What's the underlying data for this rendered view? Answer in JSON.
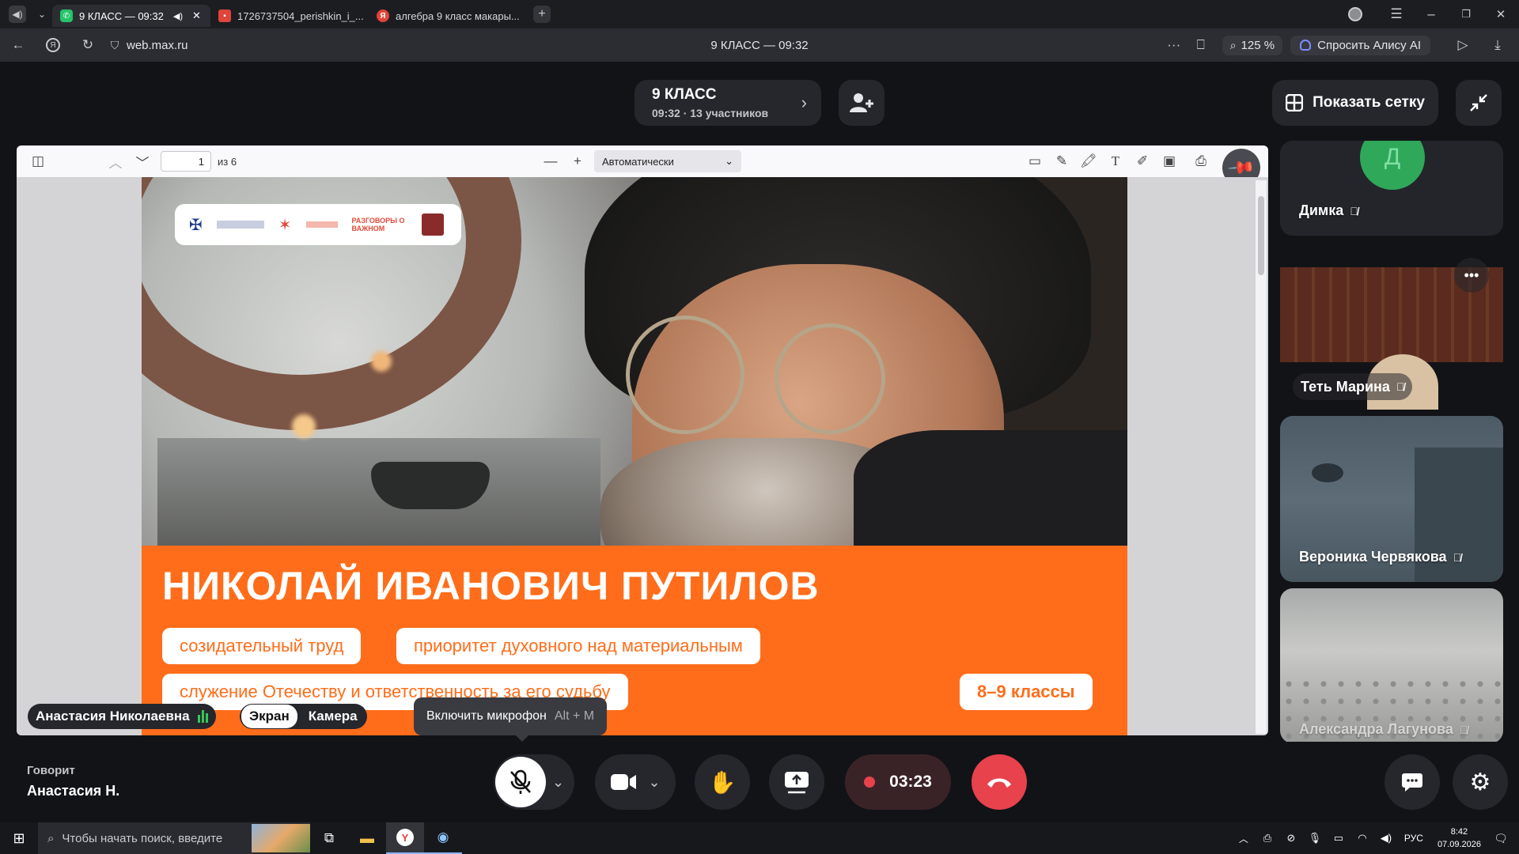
{
  "browser": {
    "tabs": [
      {
        "title": "9 КЛАСС — 09:32",
        "active": true
      },
      {
        "title": "1726737504_perishkin_i_..."
      },
      {
        "title": "алгебра 9 класс макары..."
      }
    ],
    "url": "web.max.ru",
    "page_title": "9 КЛАСС — 09:32",
    "zoom": "125 %",
    "alice_label": "Спросить Алису AI"
  },
  "call": {
    "name": "9 КЛАСС",
    "subtitle": "09:32 · 13 участников",
    "show_grid_label": "Показать сетку"
  },
  "pdf": {
    "page": "1",
    "page_of": "из 6",
    "zoom_select": "Автоматически"
  },
  "slide": {
    "logo_text": "РАЗГОВОРЫ О ВАЖНОМ",
    "title": "НИКОЛАЙ ИВАНОВИЧ ПУТИЛОВ",
    "tags": [
      "созидательный труд",
      "приоритет духовного над материальным",
      "служение Отечеству и ответственность за его судьбу"
    ],
    "grade": "8–9 классы"
  },
  "presenter": {
    "name": "Анастасия Николаевна",
    "screen_label": "Экран",
    "camera_label": "Камера"
  },
  "tooltip": {
    "text": "Включить микрофон",
    "shortcut": "Alt + M"
  },
  "participants": [
    {
      "name": "Димка",
      "initial": "Д"
    },
    {
      "name": "Теть Марина"
    },
    {
      "name": "Вероника Червякова"
    },
    {
      "name": "Александра Лагунова"
    }
  ],
  "speaking": {
    "label": "Говорит",
    "name": "Анастасия Н."
  },
  "controls": {
    "timer": "03:23"
  },
  "taskbar": {
    "search_placeholder": "Чтобы начать поиск, введите",
    "lang": "РУС",
    "time": "8:42",
    "date": "07.09.2026"
  },
  "colors": {
    "accent_orange": "#ff6d1a",
    "end_call_red": "#e8424d",
    "record_red": "#e8424d",
    "speaking_green": "#35c759"
  }
}
